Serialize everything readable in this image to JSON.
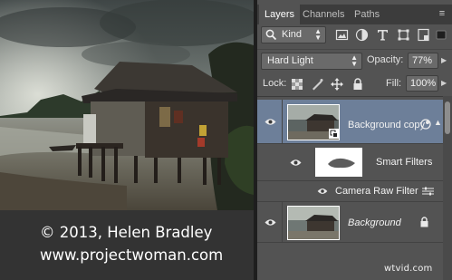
{
  "caption": {
    "line1": "© 2013, Helen Bradley",
    "line2": "www.projectwoman.com"
  },
  "tabs": [
    {
      "label": "Layers",
      "active": true
    },
    {
      "label": "Channels",
      "active": false
    },
    {
      "label": "Paths",
      "active": false
    }
  ],
  "panel_menu_icon": "panel-menu-icon",
  "filter": {
    "kind_label": "Kind",
    "icons": [
      "image-filter-icon",
      "adjustment-filter-icon",
      "type-filter-icon",
      "shape-filter-icon",
      "smart-object-filter-icon"
    ]
  },
  "blend": {
    "mode": "Hard Light",
    "opacity_label": "Opacity:",
    "opacity_value": "77%"
  },
  "lock": {
    "label": "Lock:",
    "fill_label": "Fill:",
    "fill_value": "100%",
    "icons": [
      "lock-transparent-icon",
      "lock-image-icon",
      "lock-position-icon",
      "lock-all-icon"
    ]
  },
  "layers": [
    {
      "name": "Background copy",
      "selected": true,
      "visible": true,
      "smart_object": true
    },
    {
      "name": "Smart Filters",
      "visible": true
    },
    {
      "name": "Camera Raw Filter",
      "visible": true
    },
    {
      "name": "Background",
      "visible": true,
      "locked": true,
      "italic": true
    }
  ],
  "watermark": "wtvid.com",
  "colors": {
    "panel_bg": "#535353",
    "selected_layer": "#6d7f99",
    "tab_bar": "#3c3c3c"
  }
}
